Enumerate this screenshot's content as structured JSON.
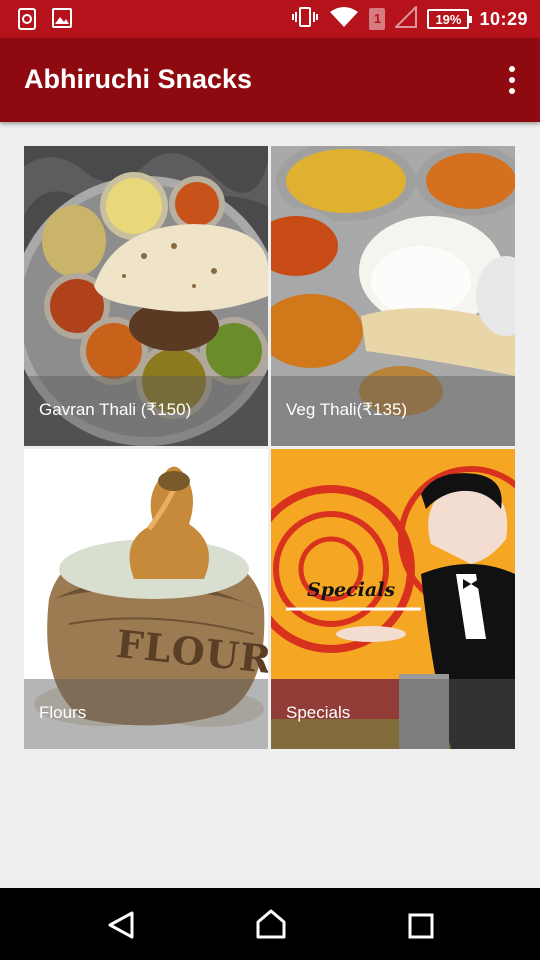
{
  "status_bar": {
    "time": "10:29",
    "battery": "19%",
    "sim_slot": "1",
    "icons": [
      "screenshot-icon",
      "gallery-icon",
      "vibrate-icon",
      "wifi-icon",
      "sim-icon",
      "signal-icon",
      "battery-icon"
    ]
  },
  "app_bar": {
    "title": "Abhiruchi Snacks",
    "menu_icon": "overflow-menu-icon"
  },
  "categories": [
    {
      "label": "Gavran Thali (₹150)"
    },
    {
      "label": "Veg Thali(₹135)"
    },
    {
      "label": "Flours",
      "image_text": "FLOUR"
    },
    {
      "label": "Specials",
      "image_text": "Specials"
    }
  ],
  "nav_bar": {
    "icons": [
      "back-icon",
      "home-icon",
      "recents-icon"
    ]
  },
  "colors": {
    "status_bar": "#b5121b",
    "app_bar": "#8e0a10",
    "background": "#efefef",
    "nav_bar": "#000000"
  }
}
